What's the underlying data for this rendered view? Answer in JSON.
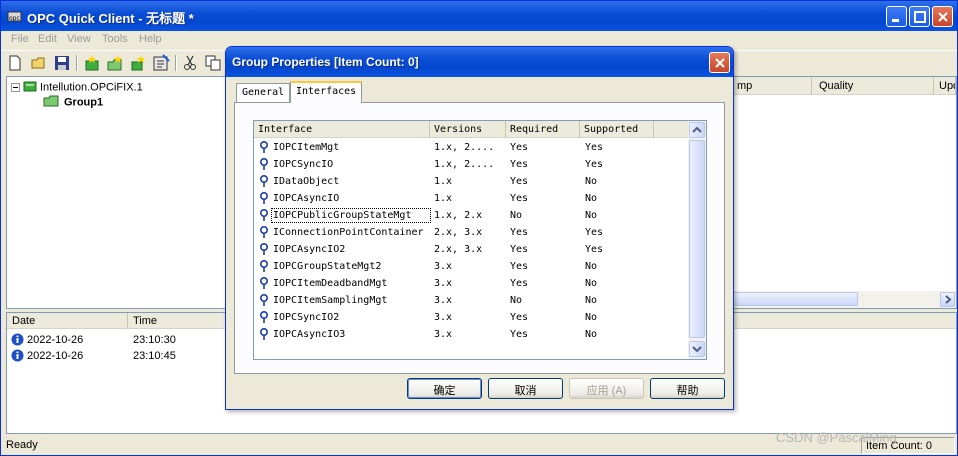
{
  "main": {
    "title": "OPC Quick Client - 无标题 *",
    "menu": [
      "File",
      "Edit",
      "View",
      "Tools",
      "Help"
    ],
    "tree": {
      "server": "Intellution.OPCiFIX.1",
      "group": "Group1"
    },
    "item_columns": [
      "mp",
      "Quality",
      "Upd"
    ],
    "log": {
      "columns": [
        "Date",
        "Time"
      ],
      "rows": [
        {
          "date": "2022-10-26",
          "time": "23:10:30"
        },
        {
          "date": "2022-10-26",
          "time": "23:10:45"
        }
      ]
    },
    "status": {
      "ready": "Ready",
      "item_count": "Item Count: 0"
    }
  },
  "dialog": {
    "title": "Group Properties [Item Count: 0]",
    "tabs": [
      "General",
      "Interfaces"
    ],
    "columns": [
      "Interface",
      "Versions",
      "Required",
      "Supported"
    ],
    "rows": [
      {
        "name": "IOPCItemMgt",
        "ver": "1.x, 2....",
        "req": "Yes",
        "sup": "Yes"
      },
      {
        "name": "IOPCSyncIO",
        "ver": "1.x, 2....",
        "req": "Yes",
        "sup": "Yes"
      },
      {
        "name": "IDataObject",
        "ver": "1.x",
        "req": "Yes",
        "sup": "No"
      },
      {
        "name": "IOPCAsyncIO",
        "ver": "1.x",
        "req": "Yes",
        "sup": "No"
      },
      {
        "name": "IOPCPublicGroupStateMgt",
        "ver": "1.x, 2.x",
        "req": "No",
        "sup": "No"
      },
      {
        "name": "IConnectionPointContainer",
        "ver": "2.x, 3.x",
        "req": "Yes",
        "sup": "Yes"
      },
      {
        "name": "IOPCAsyncIO2",
        "ver": "2.x, 3.x",
        "req": "Yes",
        "sup": "Yes"
      },
      {
        "name": "IOPCGroupStateMgt2",
        "ver": "3.x",
        "req": "Yes",
        "sup": "No"
      },
      {
        "name": "IOPCItemDeadbandMgt",
        "ver": "3.x",
        "req": "Yes",
        "sup": "No"
      },
      {
        "name": "IOPCItemSamplingMgt",
        "ver": "3.x",
        "req": "No",
        "sup": "No"
      },
      {
        "name": "IOPCSyncIO2",
        "ver": "3.x",
        "req": "Yes",
        "sup": "No"
      },
      {
        "name": "IOPCAsyncIO3",
        "ver": "3.x",
        "req": "Yes",
        "sup": "No"
      }
    ],
    "buttons": {
      "ok": "确定",
      "cancel": "取消",
      "apply": "应用 (A)",
      "help": "帮助"
    }
  },
  "watermark": "CSDN @PascalMing",
  "colors": {
    "titlebar": "#0a4ed6",
    "window_bg": "#ece9d8",
    "list_border": "#7f9db9"
  }
}
